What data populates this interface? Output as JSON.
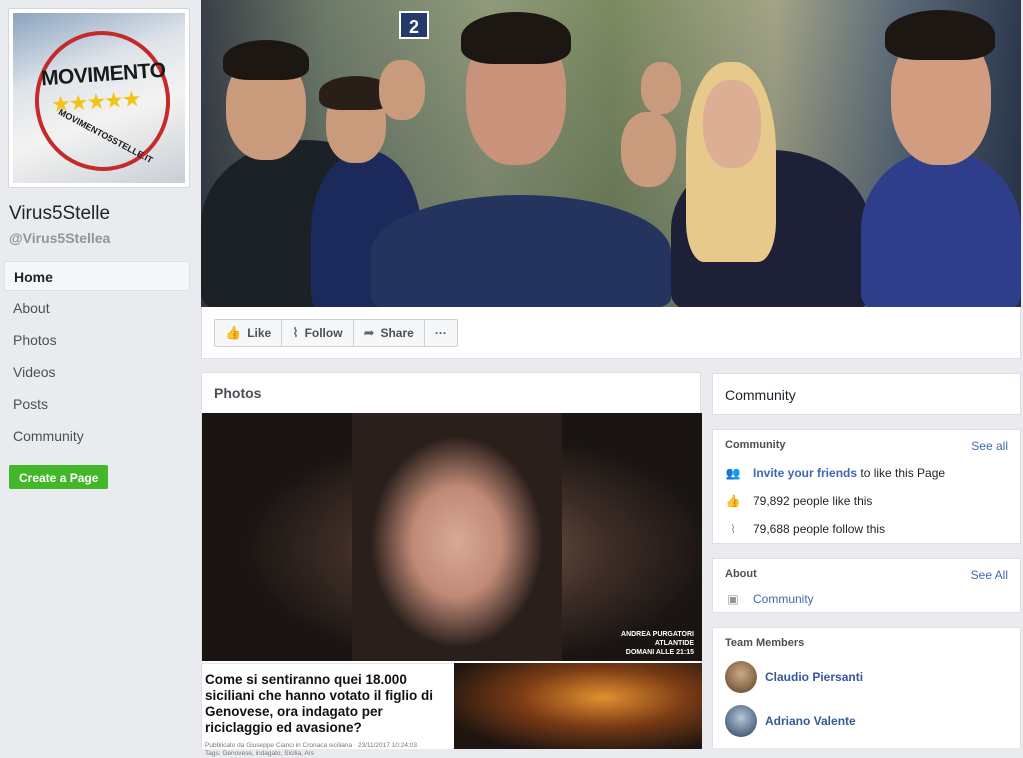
{
  "page": {
    "name": "Virus5Stelle",
    "handle": "@Virus5Stellea",
    "logo": {
      "word": "MOVIMENTO",
      "stars": "★★★★★",
      "url": "MOVIMENTO5STELLE.IT"
    }
  },
  "nav": {
    "items": [
      "Home",
      "About",
      "Photos",
      "Videos",
      "Posts",
      "Community"
    ],
    "active": "Home"
  },
  "create_page_label": "Create a Page",
  "cover": {
    "sign_number": "2"
  },
  "actions": {
    "like": "Like",
    "follow": "Follow",
    "share": "Share",
    "more": "···"
  },
  "photos": {
    "title": "Photos",
    "caption_lines": [
      "ANDREA PURGATORI",
      "ATLANTIDE",
      "DOMANI ALLE 21:15"
    ],
    "headline": "Come si sentiranno quei 18.000 siciliani che hanno votato il figlio di Genovese, ora indagato per riciclaggio ed avasione?",
    "meta_line1": "Pubblicato da Giuseppe Cianci in Cronaca siciliana · 23/11/2017 10:24:03",
    "meta_line2": "Tags: Genovese, indagato, Sicilia, Ars"
  },
  "community_header": "Community",
  "community": {
    "title": "Community",
    "see_all": "See all",
    "invite_link": "Invite your friends",
    "invite_rest": " to like this Page",
    "likes": "79,892 people like this",
    "follows": "79,688 people follow this"
  },
  "about": {
    "title": "About",
    "see_all": "See All",
    "item": "Community"
  },
  "team": {
    "title": "Team Members",
    "members": [
      "Claudio Piersanti",
      "Adriano Valente"
    ]
  },
  "colors": {
    "link": "#4267b2",
    "create_button": "#42b72a",
    "background": "#e9ebee"
  }
}
